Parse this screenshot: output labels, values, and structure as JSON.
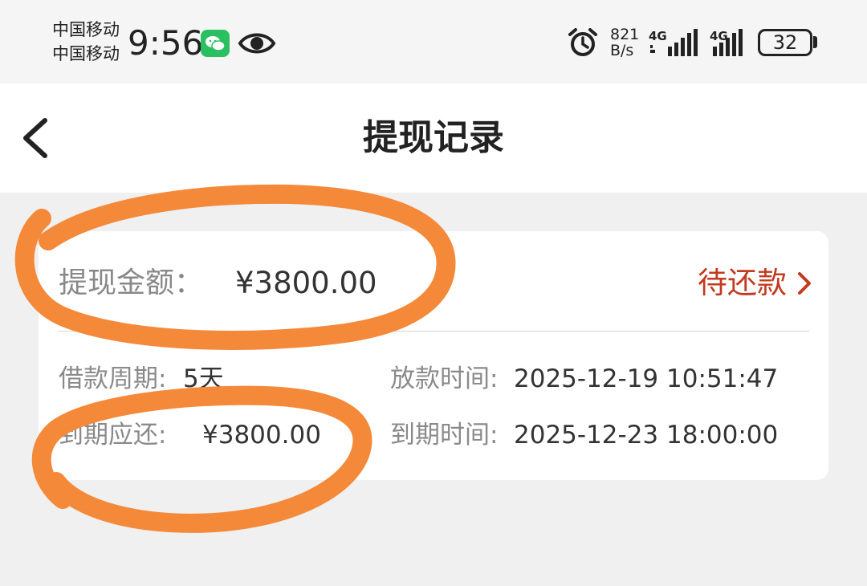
{
  "status_bar": {
    "carrier_1": "中国移动",
    "carrier_2": "中国移动",
    "time": "9:56",
    "net_speed_value": "821",
    "net_speed_unit": "B/s",
    "signal_1_label": "4G",
    "signal_2_label": "4G",
    "battery": "32",
    "icons": [
      "wechat-icon",
      "eye-icon",
      "alarm-icon",
      "signal-icon",
      "battery-icon"
    ]
  },
  "header": {
    "title": "提现记录",
    "back_icon": "chevron-left-icon"
  },
  "record": {
    "amount_label": "提现金额：",
    "amount_value": "¥3800.00",
    "status": "待还款",
    "status_color": "#c23a1f",
    "loan_period_label": "借款周期:",
    "loan_period_value": "5天",
    "release_time_label": "放款时间:",
    "release_time_value": "2025-12-19 10:51:47",
    "due_amount_label": "到期应还:",
    "due_amount_value": "¥3800.00",
    "due_time_label": "到期时间:",
    "due_time_value": "2025-12-23 18:00:00"
  },
  "annotation_color": "#f5893a"
}
